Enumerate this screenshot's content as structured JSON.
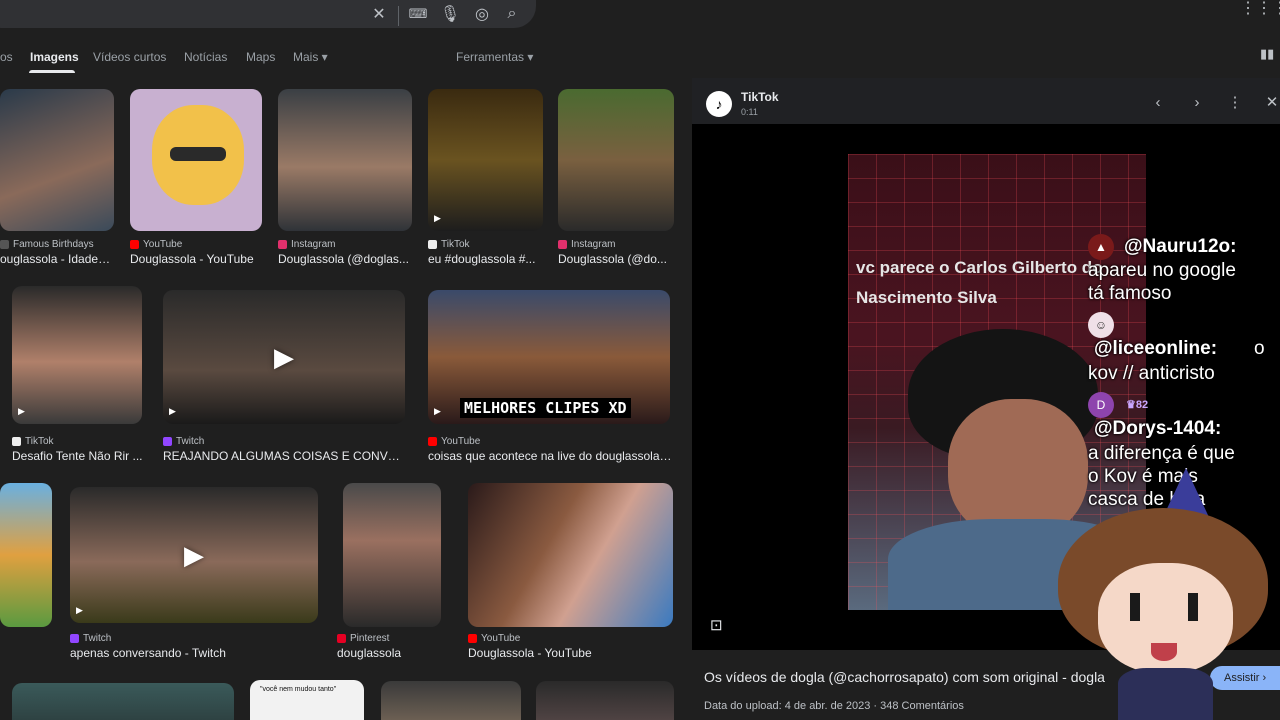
{
  "search": {
    "clear_icon": "close-icon",
    "keyboard_icon": "keyboard-icon",
    "mic_icon": "mic-icon",
    "lens_icon": "lens-icon",
    "search_icon": "search-icon"
  },
  "tabs": {
    "items": [
      "os",
      "Imagens",
      "Vídeos curtos",
      "Notícias",
      "Maps",
      "Mais ▾"
    ],
    "tools": "Ferramentas ▾"
  },
  "results": [
    {
      "source": "Famous Birthdays",
      "caption": "ouglassola - Idade, ...",
      "src_color": "#555"
    },
    {
      "source": "YouTube",
      "caption": "Douglassola - YouTube",
      "src_color": "#ff0000"
    },
    {
      "source": "Instagram",
      "caption": "Douglassola (@doglas...",
      "src_color": "#e1306c"
    },
    {
      "source": "TikTok",
      "caption": "eu #douglassola #...",
      "src_color": "#eee"
    },
    {
      "source": "Instagram",
      "caption": "Douglassola (@do...",
      "src_color": "#e1306c"
    },
    {
      "source": "TikTok",
      "caption": "Desafio Tente Não Rir ...",
      "src_color": "#eee"
    },
    {
      "source": "Twitch",
      "caption": "REAJANDO ALGUMAS COISAS E CONVER...",
      "src_color": "#9146ff"
    },
    {
      "source": "YouTube",
      "caption": "coisas que acontece na live do douglassola -...",
      "src_color": "#ff0000"
    },
    {
      "source": "Twitch",
      "caption": "apenas conversando - Twitch",
      "src_color": "#9146ff"
    },
    {
      "source": "Pinterest",
      "caption": "douglassola",
      "src_color": "#e60023"
    },
    {
      "source": "YouTube",
      "caption": "Douglassola - YouTube",
      "src_color": "#ff0000"
    }
  ],
  "thumb_texts": {
    "melhores": "MELHORES CLIPES XD",
    "nem_mudou": "\"você nem mudou tanto\""
  },
  "panel": {
    "title": "TikTok",
    "duration": "0:11",
    "video_text_1": "vc parece o Carlos Gilberto do",
    "video_text_2": "Nascimento Silva",
    "caption": "Os vídeos de dogla (@cachorrosapato) com som original - dogla",
    "meta": "Data do upload: 4 de abr. de 2023 · 348 Comentários",
    "watch_label": "Assistir ›"
  },
  "chat": [
    {
      "user": "@Nauru12o:",
      "msg_1": "apareu no google",
      "msg_2": "tá famoso"
    },
    {
      "user": "@liceeonline:",
      "user_suffix": "o",
      "msg_1": "kov // anticristo"
    },
    {
      "avatar": "D",
      "badge": "82",
      "user": "@Dorys-1404:",
      "msg_1": "a diferença é que",
      "msg_2": "o Kov é mais",
      "msg_3": "casca de bala"
    }
  ]
}
